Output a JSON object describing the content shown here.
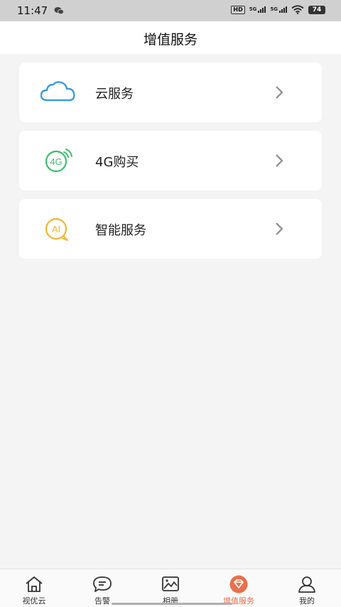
{
  "status_bar": {
    "time": "11:47",
    "hd_label": "HD",
    "signal1_label": "5G",
    "signal2_label": "5G",
    "battery": "74",
    "icons": [
      "wechat-icon",
      "wifi-icon",
      "battery-icon"
    ]
  },
  "header": {
    "title": "增值服务"
  },
  "services": [
    {
      "label": "云服务",
      "icon": "cloud-icon",
      "color": "#3b9be0"
    },
    {
      "label": "4G购买",
      "icon": "4g-icon",
      "color": "#3cbf6c"
    },
    {
      "label": "智能服务",
      "icon": "ai-icon",
      "color": "#f2b632"
    }
  ],
  "tabbar": {
    "tabs": [
      {
        "label": "视优云",
        "icon": "home-icon",
        "active": false
      },
      {
        "label": "告警",
        "icon": "message-icon",
        "active": false
      },
      {
        "label": "相册",
        "icon": "album-icon",
        "active": false
      },
      {
        "label": "增值服务",
        "icon": "diamond-icon",
        "active": true
      },
      {
        "label": "我的",
        "icon": "user-icon",
        "active": false
      }
    ],
    "active_color": "#e8704c"
  }
}
